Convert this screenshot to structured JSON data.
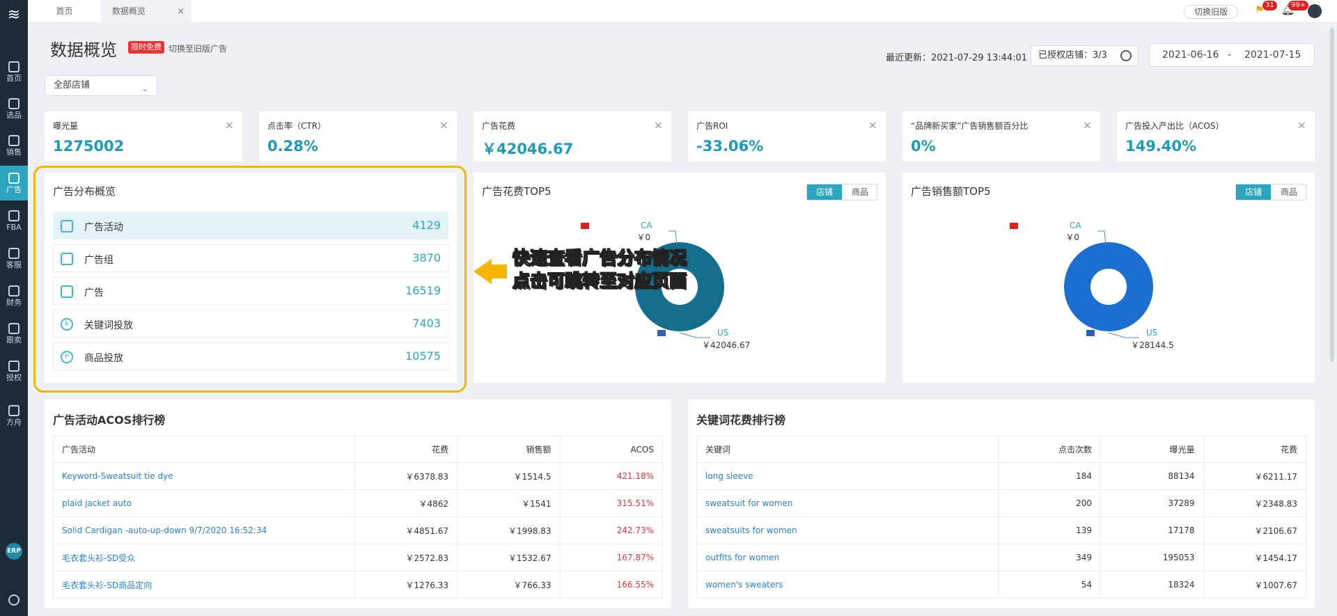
{
  "sidebar": {
    "items": [
      {
        "label": "首页",
        "icon": "home-icon"
      },
      {
        "label": "选品",
        "icon": "search-icon"
      },
      {
        "label": "销售",
        "icon": "chart-icon"
      },
      {
        "label": "广告",
        "icon": "ad-icon"
      },
      {
        "label": "FBA",
        "icon": "fba-icon"
      },
      {
        "label": "客服",
        "icon": "message-icon"
      },
      {
        "label": "财务",
        "icon": "dollar-icon"
      },
      {
        "label": "跟卖",
        "icon": "pie-icon"
      },
      {
        "label": "授权",
        "icon": "shield-icon"
      },
      {
        "label": "方舟",
        "icon": "ark-icon"
      }
    ],
    "erp_label": "ERP"
  },
  "tabs": {
    "home": "首页",
    "overview": "数据概览",
    "close": "×"
  },
  "topbar": {
    "old_version": "切换旧版",
    "flag_count": "31",
    "bell_count": "99+"
  },
  "header": {
    "title": "数据概览",
    "promo": "限时免费",
    "switch_link": "切换至旧版广告",
    "last_update": "最近更新：2021-07-29 13:44:01",
    "authorized_stores": "已授权店铺：3/3",
    "date_start": "2021-06-16",
    "date_sep": "-",
    "date_end": "2021-07-15",
    "store_select": "全部店铺"
  },
  "kpis": [
    {
      "label": "曝光量",
      "value": "1275002"
    },
    {
      "label": "点击率（CTR）",
      "value": "0.28%"
    },
    {
      "label": "广告花费",
      "value": "￥42046.67"
    },
    {
      "label": "广告ROI",
      "value": "-33.06%"
    },
    {
      "label": "“品牌新买家”广告销售额百分比",
      "value": "0%"
    },
    {
      "label": "广告投入产出比（ACOS）",
      "value": "149.40%"
    }
  ],
  "distribution": {
    "title": "广告分布概览",
    "rows": [
      {
        "label": "广告活动",
        "value": "4129",
        "icon": "grid-icon"
      },
      {
        "label": "广告组",
        "value": "3870",
        "icon": "copy-icon"
      },
      {
        "label": "广告",
        "value": "16519",
        "icon": "ad-icon"
      },
      {
        "label": "关键词投放",
        "value": "7403",
        "icon": "keyword-icon",
        "glyph": "K"
      },
      {
        "label": "商品投放",
        "value": "10575",
        "icon": "product-icon",
        "glyph": "P"
      }
    ]
  },
  "callout": {
    "line1": "快速查看广告分布情况",
    "line2": "点击可跳转至对应页面"
  },
  "chart_data": [
    {
      "type": "pie",
      "title": "广告花费TOP5",
      "toggle": [
        "店铺",
        "商品"
      ],
      "categories": [
        "CA",
        "US"
      ],
      "values": [
        0,
        42046.67
      ],
      "value_labels": [
        "￥0",
        "￥42046.67"
      ],
      "colors": [
        "#1e8ab0",
        "#146e8c"
      ]
    },
    {
      "type": "pie",
      "title": "广告销售额TOP5",
      "toggle": [
        "店铺",
        "商品"
      ],
      "categories": [
        "CA",
        "US"
      ],
      "values": [
        0,
        28144.5
      ],
      "value_labels": [
        "￥0",
        "￥28144.5"
      ],
      "colors": [
        "#1e8ab0",
        "#1a6fd0"
      ]
    }
  ],
  "acos_table": {
    "title": "广告活动ACOS排行榜",
    "headers": [
      "广告活动",
      "花费",
      "销售额",
      "ACOS"
    ],
    "rows": [
      [
        "Keyword-Sweatsuit tie dye",
        "￥6378.83",
        "￥1514.5",
        "421.18%"
      ],
      [
        "plaid jacket auto",
        "￥4862",
        "￥1541",
        "315.51%"
      ],
      [
        "Solid Cardigan -auto-up-down 9/7/2020 16:52:34",
        "￥4851.67",
        "￥1998.83",
        "242.73%"
      ],
      [
        "毛衣套头衫-SD受众",
        "￥2572.83",
        "￥1532.67",
        "167.87%"
      ],
      [
        "毛衣套头衫-SD商品定向",
        "￥1276.33",
        "￥766.33",
        "166.55%"
      ]
    ]
  },
  "keyword_table": {
    "title": "关键词花费排行榜",
    "headers": [
      "关键词",
      "点击次数",
      "曝光量",
      "花费"
    ],
    "rows": [
      [
        "long sleeve",
        "184",
        "88134",
        "￥6211.17"
      ],
      [
        "sweatsuit for women",
        "200",
        "37289",
        "￥2348.83"
      ],
      [
        "sweatsuits for women",
        "139",
        "17178",
        "￥2106.67"
      ],
      [
        "outfits for women",
        "349",
        "195053",
        "￥1454.17"
      ],
      [
        "women's sweaters",
        "54",
        "18324",
        "￥1007.67"
      ]
    ]
  }
}
